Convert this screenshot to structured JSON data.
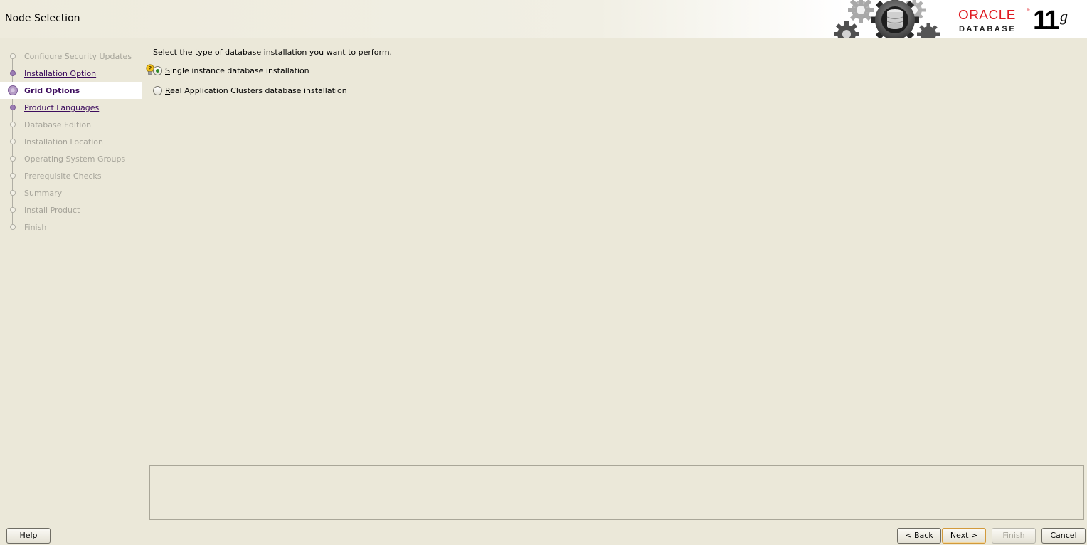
{
  "header": {
    "title": "Node Selection",
    "brand": {
      "oracle": "ORACLE",
      "trademark": "®",
      "product": "DATABASE",
      "version_number": "11",
      "version_letter": "g"
    }
  },
  "sidebar": {
    "steps": [
      {
        "label": "Configure Security Updates",
        "state": "disabled"
      },
      {
        "label": "Installation Option",
        "state": "visited"
      },
      {
        "label": "Grid Options",
        "state": "current"
      },
      {
        "label": "Product Languages",
        "state": "visited"
      },
      {
        "label": "Database Edition",
        "state": "disabled"
      },
      {
        "label": "Installation Location",
        "state": "disabled"
      },
      {
        "label": "Operating System Groups",
        "state": "disabled"
      },
      {
        "label": "Prerequisite Checks",
        "state": "disabled"
      },
      {
        "label": "Summary",
        "state": "disabled"
      },
      {
        "label": "Install Product",
        "state": "disabled"
      },
      {
        "label": "Finish",
        "state": "disabled"
      }
    ]
  },
  "main": {
    "instruction": "Select the type of database installation you want to perform.",
    "options": [
      {
        "mnemonic": "S",
        "rest": "ingle instance database installation",
        "checked": true
      },
      {
        "mnemonic": "R",
        "rest": "eal Application Clusters database installation",
        "checked": false
      }
    ],
    "message_text": ""
  },
  "footer": {
    "help": {
      "mnemonic": "H",
      "rest": "elp"
    },
    "back": {
      "prefix": "< ",
      "mnemonic": "B",
      "rest": "ack"
    },
    "next": {
      "mnemonic": "N",
      "rest": "ext >"
    },
    "finish": {
      "mnemonic": "F",
      "rest": "inish"
    },
    "cancel": {
      "label": "Cancel"
    }
  },
  "colors": {
    "background": "#ebe8d9",
    "visited_step": "#3d0d5e",
    "disabled_text": "#a6a49a",
    "oracle_red": "#e01b22",
    "radio_selected": "#2f8a2c",
    "default_button_border": "#d29a3c"
  }
}
